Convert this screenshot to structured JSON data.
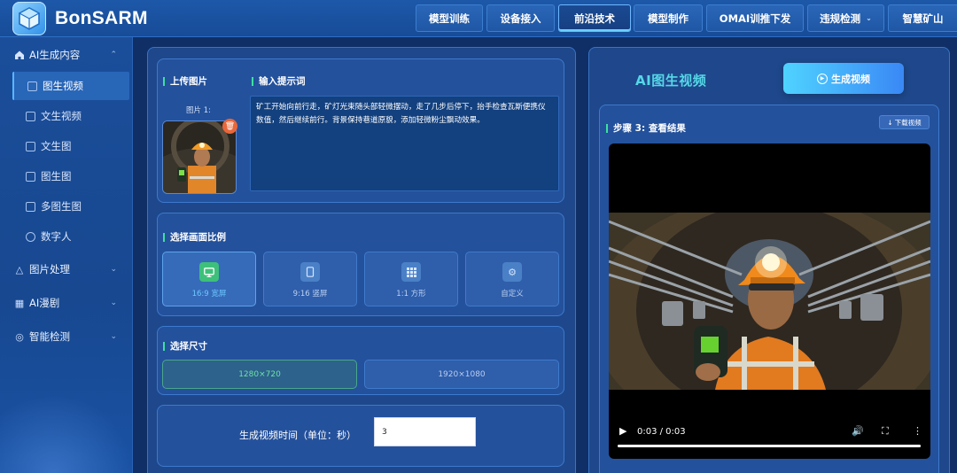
{
  "app": {
    "name": "BonSARM"
  },
  "nav": {
    "items": [
      {
        "label": "模型训练"
      },
      {
        "label": "设备接入"
      },
      {
        "label": "前沿技术",
        "active": true
      },
      {
        "label": "模型制作"
      },
      {
        "label": "OMAI训推下发"
      },
      {
        "label": "违规检测",
        "has_dropdown": true
      },
      {
        "label": "智慧矿山"
      }
    ]
  },
  "sidebar": {
    "groups": [
      {
        "label": "AI生成内容",
        "icon": "home-icon",
        "expanded": true
      },
      {
        "label": "图片处理",
        "icon": "trophy-icon"
      },
      {
        "label": "AI漫剧",
        "icon": "film-icon"
      },
      {
        "label": "智能检测",
        "icon": "target-icon"
      }
    ],
    "items": [
      {
        "label": "图生视频",
        "icon": "video-icon",
        "active": true
      },
      {
        "label": "文生视频",
        "icon": "camera-icon"
      },
      {
        "label": "文生图",
        "icon": "edit-image-icon"
      },
      {
        "label": "图生图",
        "icon": "image-icon"
      },
      {
        "label": "多图生图",
        "icon": "images-icon"
      },
      {
        "label": "数字人",
        "icon": "play-circle-icon"
      }
    ]
  },
  "upload": {
    "title": "上传图片",
    "image_label": "图片 1:"
  },
  "prompt": {
    "title": "输入提示词",
    "value": "矿工开始向前行走，矿灯光束随头部轻微摆动，走了几步后停下，抬手检查瓦斯便携仪数值，然后继续前行。背景保持巷道原貌，添加轻微粉尘飘动效果。"
  },
  "ratio": {
    "title": "选择画面比例",
    "options": [
      {
        "label": "16:9 宽屏",
        "icon": "monitor-icon",
        "selected": true
      },
      {
        "label": "9:16 竖屏",
        "icon": "phone-icon"
      },
      {
        "label": "1:1 方形",
        "icon": "grid-icon"
      },
      {
        "label": "自定义",
        "icon": "gear-icon"
      }
    ]
  },
  "size": {
    "title": "选择尺寸",
    "options": [
      {
        "label": "1280×720",
        "selected": true
      },
      {
        "label": "1920×1080"
      }
    ]
  },
  "duration": {
    "label": "生成视频时间（单位：秒）",
    "value": "3"
  },
  "right": {
    "title": "AI图生视频",
    "generate_button": "生成视频",
    "step_title": "步骤 3: 查看结果",
    "download_button": "下载视频",
    "video": {
      "time": "0:03 / 0:03",
      "progress": 1.0
    }
  },
  "colors": {
    "accent_green": "#3ee0a0",
    "accent_blue": "#4fd3ff",
    "panel_bg": "#2c5caa"
  }
}
